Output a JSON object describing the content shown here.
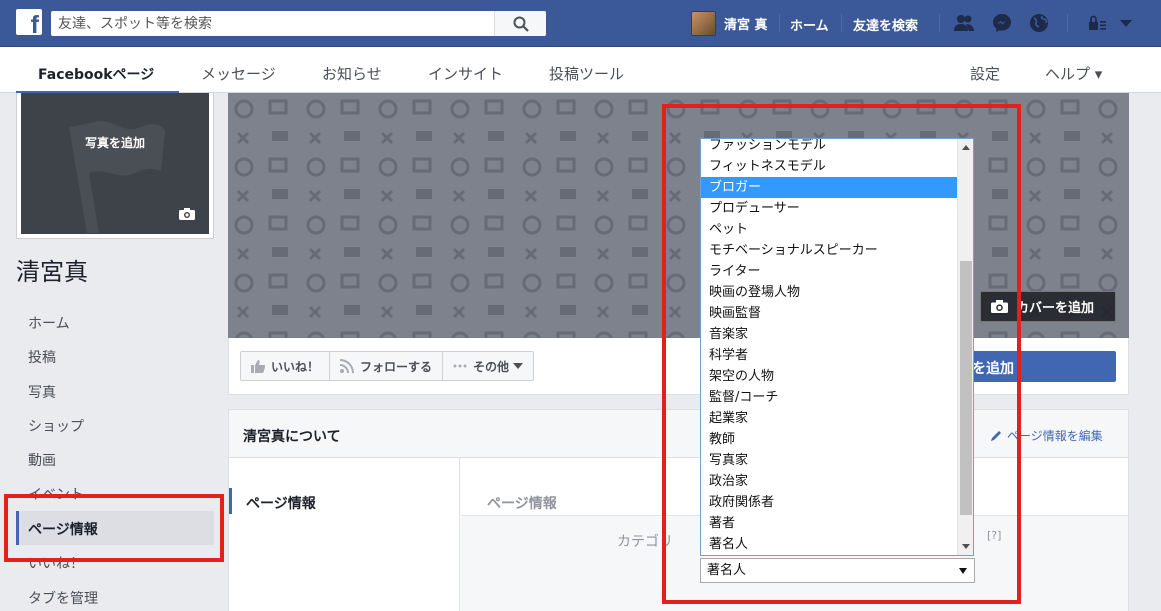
{
  "topbar": {
    "logo": "f",
    "search_placeholder": "友達、スポット等を検索",
    "user_name": "清宮 真",
    "links": [
      "ホーム",
      "友達を検索"
    ]
  },
  "subnav": {
    "items": [
      "Facebookページ",
      "メッセージ",
      "お知らせ",
      "インサイト",
      "投稿ツール"
    ],
    "right_items": [
      "設定",
      "ヘルプ ▾"
    ]
  },
  "sidebar": {
    "add_photo": "写真を追加",
    "page_name": "清宮真",
    "items": [
      "ホーム",
      "投稿",
      "写真",
      "ショップ",
      "動画",
      "イベント",
      "ページ情報",
      "いいね！",
      "タブを管理"
    ],
    "active_index": 6
  },
  "cover": {
    "add_cover": "カバーを追加"
  },
  "actions": {
    "like": "いいね！",
    "follow": "フォローする",
    "more": "その他",
    "blue_button": "を追加"
  },
  "about": {
    "title": "清宮真について",
    "edit": "ページ情報を編集",
    "left_item": "ページ情報",
    "section": "ページ情報",
    "category_label": "カテゴリ",
    "help": "[?]"
  },
  "category_select": {
    "options": [
      "ファッションモデル",
      "フィットネスモデル",
      "ブロガー",
      "プロデューサー",
      "ペット",
      "モチベーショナルスピーカー",
      "ライター",
      "映画の登場人物",
      "映画監督",
      "音楽家",
      "科学者",
      "架空の人物",
      "監督/コーチ",
      "起業家",
      "教師",
      "写真家",
      "政治家",
      "政府関係者",
      "著者",
      "著名人"
    ],
    "highlighted": "ブロガー",
    "selected_value": "著名人"
  },
  "colors": {
    "fb_blue": "#3b5998",
    "accent": "#4267b2",
    "highlight_red": "#e3201b",
    "option_highlight": "#3399ff"
  }
}
